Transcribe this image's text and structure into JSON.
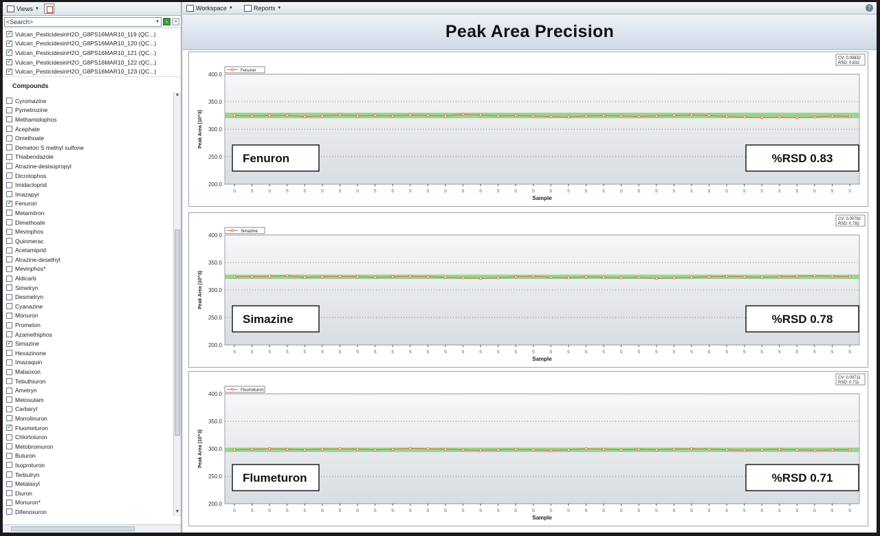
{
  "left_panel": {
    "toolbar": {
      "views_label": "Views"
    },
    "search": {
      "value": "<Search>"
    },
    "files": [
      {
        "label": "Vulcan_PesticidesinH2O_G8PS16MAR10_119 (QC...)",
        "checked": true
      },
      {
        "label": "Vulcan_PesticidesinH2O_G8PS16MAR10_120 (QC...)",
        "checked": true
      },
      {
        "label": "Vulcan_PesticidesinH2O_G8PS16MAR10_121 (QC...)",
        "checked": true
      },
      {
        "label": "Vulcan_PesticidesinH2O_G8PS16MAR10_122 (QC...)",
        "checked": true
      },
      {
        "label": "Vulcan_PesticidesinH2O_G8PS16MAR10_123 (QC...)",
        "checked": true
      }
    ],
    "compounds_title": "Compounds",
    "compounds": [
      {
        "label": "Cyromazine",
        "checked": false
      },
      {
        "label": "Pymetrozine",
        "checked": false
      },
      {
        "label": "Methamidophos",
        "checked": false
      },
      {
        "label": "Acephate",
        "checked": false
      },
      {
        "label": "Omethoate",
        "checked": false
      },
      {
        "label": "Demeton S methyl sulfone",
        "checked": false
      },
      {
        "label": "Thiabendazole",
        "checked": false
      },
      {
        "label": "Atrazine-desisopropyl",
        "checked": false
      },
      {
        "label": "Dicrotophos",
        "checked": false
      },
      {
        "label": "Imidacloprid",
        "checked": false
      },
      {
        "label": "Imazapyr",
        "checked": false
      },
      {
        "label": "Fenuron",
        "checked": true
      },
      {
        "label": "Metamitron",
        "checked": false
      },
      {
        "label": "Dimethoate",
        "checked": false
      },
      {
        "label": "Mevinphos",
        "checked": false
      },
      {
        "label": "Quinmerac",
        "checked": false
      },
      {
        "label": "Acetamiprid",
        "checked": false
      },
      {
        "label": "Atrazine-desethyl",
        "checked": false
      },
      {
        "label": "Mevinphos*",
        "checked": false
      },
      {
        "label": "Aldicarb",
        "checked": false
      },
      {
        "label": "Simetryn",
        "checked": false
      },
      {
        "label": "Desmetryn",
        "checked": false
      },
      {
        "label": "Cyanazine",
        "checked": false
      },
      {
        "label": "Monuron",
        "checked": false
      },
      {
        "label": "Prometon",
        "checked": false
      },
      {
        "label": "Azamethiphos",
        "checked": false
      },
      {
        "label": "Simazine",
        "checked": true
      },
      {
        "label": "Hexazinone",
        "checked": false
      },
      {
        "label": "Imazaquin",
        "checked": false
      },
      {
        "label": "Malaoxon",
        "checked": false
      },
      {
        "label": "Tebuthiuron",
        "checked": false
      },
      {
        "label": "Ametryn",
        "checked": false
      },
      {
        "label": "Metosulam",
        "checked": false
      },
      {
        "label": "Carbaryl",
        "checked": false
      },
      {
        "label": "Monolinuron",
        "checked": false
      },
      {
        "label": "Fluometuron",
        "checked": true
      },
      {
        "label": "Chlortoluron",
        "checked": false
      },
      {
        "label": "Metobromuron",
        "checked": false
      },
      {
        "label": "Buturon",
        "checked": false
      },
      {
        "label": "Isoproturon",
        "checked": false
      },
      {
        "label": "Terbutryn",
        "checked": false
      },
      {
        "label": "Metalaxyl",
        "checked": false
      },
      {
        "label": "Diuron",
        "checked": false
      },
      {
        "label": "Monuron*",
        "checked": false
      },
      {
        "label": "Difenoxuron",
        "checked": false
      }
    ]
  },
  "right_panel": {
    "toolbar": {
      "workspace_label": "Workspace",
      "reports_label": "Reports",
      "help": "?"
    },
    "title": "Peak Area Precision"
  },
  "colors": {
    "band": "#8cd07a",
    "line": "#e06a4a",
    "panel_bg": "#e9ecef"
  },
  "chart_data": [
    {
      "type": "line",
      "legend": "Fenuron",
      "stats": [
        "CV: 0.00832",
        "RSD: 0.832"
      ],
      "callout": "Fenuron",
      "rsd_label": "%RSD 0.83",
      "ylabel": "Peak Area (10^3)",
      "xlabel": "Sample",
      "ylim": [
        200,
        400
      ],
      "yticks": [
        "200.0",
        "250.0",
        "300.0",
        "350.0",
        "400.0"
      ],
      "x_tick_label": "S",
      "band": [
        320,
        330
      ],
      "values": [
        325,
        324,
        325,
        325,
        323,
        324,
        326,
        324,
        325,
        324,
        326,
        325,
        324,
        327,
        326,
        324,
        325,
        324,
        323,
        322,
        324,
        325,
        324,
        323,
        324,
        325,
        326,
        325,
        323,
        322,
        321,
        322,
        321,
        322,
        324,
        323
      ]
    },
    {
      "type": "line",
      "legend": "Simazine",
      "stats": [
        "CV: 0.00782",
        "RSD: 0.782"
      ],
      "callout": "Simazine",
      "rsd_label": "%RSD 0.78",
      "ylabel": "Peak Area (10^3)",
      "xlabel": "Sample",
      "ylim": [
        200,
        400
      ],
      "yticks": [
        "200.0",
        "250.0",
        "300.0",
        "350.0",
        "400.0"
      ],
      "x_tick_label": "S",
      "band": [
        320,
        328
      ],
      "values": [
        324,
        324,
        325,
        326,
        323,
        324,
        325,
        324,
        323,
        324,
        325,
        324,
        323,
        322,
        321,
        322,
        324,
        325,
        323,
        322,
        324,
        323,
        322,
        323,
        321,
        322,
        323,
        324,
        325,
        324,
        323,
        324,
        325,
        326,
        325,
        324
      ]
    },
    {
      "type": "line",
      "legend": "Fluometuron",
      "stats": [
        "CV: 0.00711",
        "RSD: 0.711"
      ],
      "callout": "Flumeturon",
      "rsd_label": "%RSD 0.71",
      "ylabel": "Peak Area (10^3)",
      "xlabel": "Sample",
      "ylim": [
        200,
        400
      ],
      "yticks": [
        "200.0",
        "250.0",
        "300.0",
        "350.0",
        "400.0"
      ],
      "x_tick_label": "S",
      "band": [
        294,
        302
      ],
      "values": [
        298,
        299,
        300,
        299,
        298,
        299,
        300,
        299,
        298,
        299,
        301,
        300,
        299,
        298,
        297,
        298,
        299,
        298,
        297,
        298,
        300,
        299,
        298,
        299,
        298,
        299,
        300,
        299,
        298,
        297,
        298,
        299,
        298,
        297,
        298,
        298
      ]
    }
  ]
}
